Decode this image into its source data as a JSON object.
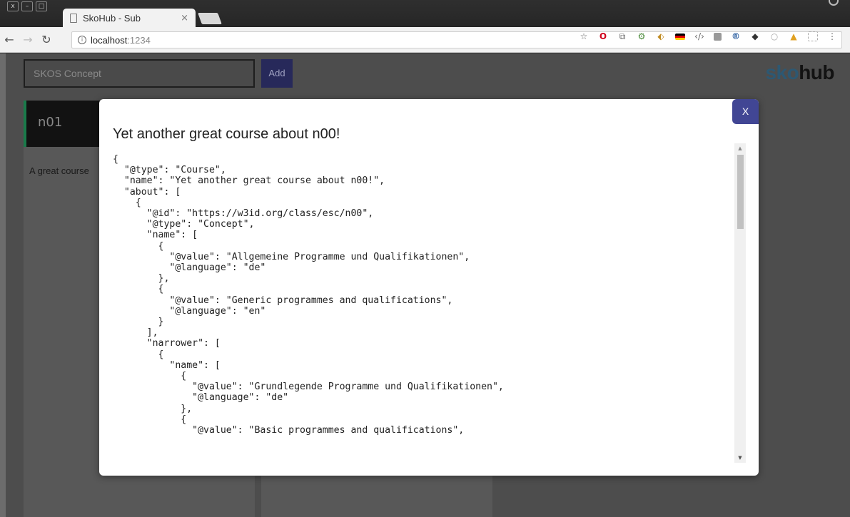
{
  "browser": {
    "tab_title": "SkoHub - Sub",
    "tab_close": "×",
    "url_host": "localhost",
    "url_port": ":1234",
    "window_buttons": [
      "x",
      "–",
      "□"
    ]
  },
  "page": {
    "concept_placeholder": "SKOS Concept",
    "add_label": "Add",
    "logo_part1": "sko",
    "logo_part2": "hub",
    "card_title": "n01",
    "card_text": "A great course"
  },
  "modal": {
    "close_label": "X",
    "title": "Yet another great course about n00!",
    "code": "{\n  \"@type\": \"Course\",\n  \"name\": \"Yet another great course about n00!\",\n  \"about\": [\n    {\n      \"@id\": \"https://w3id.org/class/esc/n00\",\n      \"@type\": \"Concept\",\n      \"name\": [\n        {\n          \"@value\": \"Allgemeine Programme und Qualifikationen\",\n          \"@language\": \"de\"\n        },\n        {\n          \"@value\": \"Generic programmes and qualifications\",\n          \"@language\": \"en\"\n        }\n      ],\n      \"narrower\": [\n        {\n          \"name\": [\n            {\n              \"@value\": \"Grundlegende Programme und Qualifikationen\",\n              \"@language\": \"de\"\n            },\n            {\n              \"@value\": \"Basic programmes and qualifications\","
  },
  "colors": {
    "accent": "#414694",
    "card_border": "#1a7a4a"
  }
}
